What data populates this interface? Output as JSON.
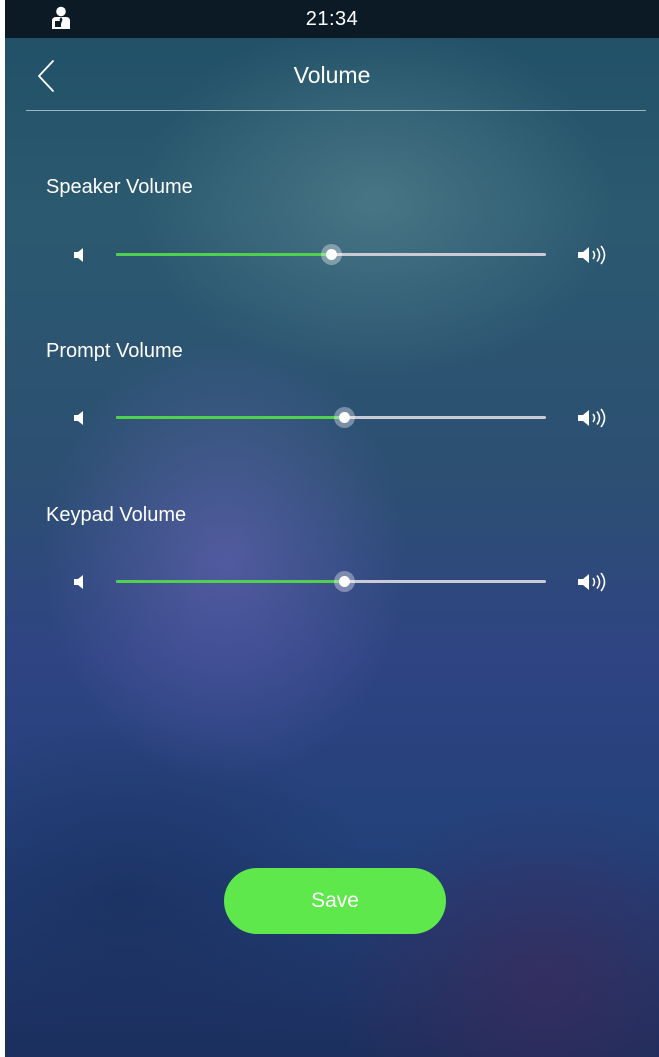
{
  "status_bar": {
    "time": "21:34",
    "user_icon": "user-icon"
  },
  "header": {
    "title": "Volume",
    "back_icon": "chevron-left-icon"
  },
  "volumes": [
    {
      "label": "Speaker Volume",
      "level_percent": 50
    },
    {
      "label": "Prompt Volume",
      "level_percent": 53
    },
    {
      "label": "Keypad Volume",
      "level_percent": 53
    }
  ],
  "icons": {
    "low": "volume-low-icon",
    "high": "volume-high-icon"
  },
  "save_label": "Save",
  "colors": {
    "accent": "#4fd14f",
    "save_button": "#5ee84c",
    "track": "#c9ccd4",
    "status_bar": "#0c1a26"
  }
}
